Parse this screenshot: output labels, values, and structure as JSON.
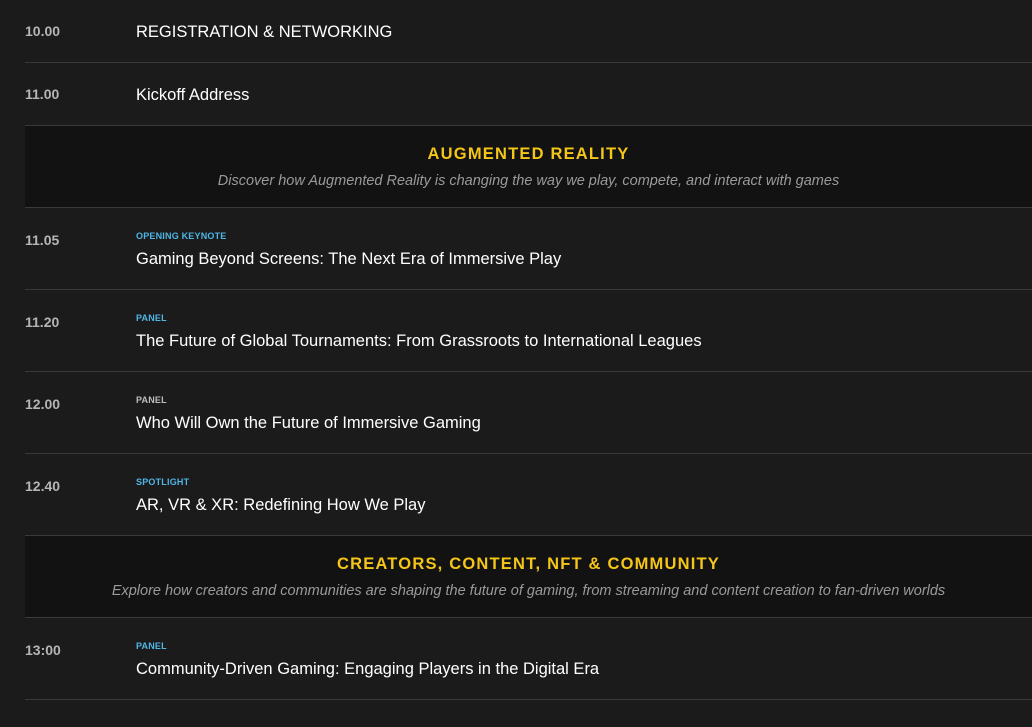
{
  "colors": {
    "background": "#1b1b1b",
    "section_background": "#121212",
    "section_title": "#f5c518",
    "tag_blue": "#4fb6e6",
    "tag_grey": "#bdbdbd",
    "time": "#b5b5b5",
    "divider": "#3a3a3a"
  },
  "agenda": {
    "row1": {
      "time": "10.00",
      "title": "REGISTRATION & NETWORKING"
    },
    "row2": {
      "time": "11.00",
      "title": "Kickoff Address"
    },
    "section1": {
      "title": "AUGMENTED REALITY",
      "description": "Discover how Augmented Reality is changing the way we play, compete, and interact with games"
    },
    "row3": {
      "time": "11.05",
      "tag": "OPENING KEYNOTE",
      "title": "Gaming Beyond Screens: The Next Era of Immersive Play"
    },
    "row4": {
      "time": "11.20",
      "tag": "PANEL",
      "title": "The Future of Global Tournaments: From Grassroots to International Leagues"
    },
    "row5": {
      "time": "12.00",
      "tag": "PANEL",
      "title": "Who Will Own the Future of Immersive Gaming"
    },
    "row6": {
      "time": "12.40",
      "tag": "SPOTLIGHT",
      "title": "AR, VR & XR: Redefining How We Play"
    },
    "section2": {
      "title": "CREATORS, CONTENT, NFT & COMMUNITY",
      "description": "Explore how creators and communities are shaping the future of gaming, from streaming and content creation to fan-driven worlds"
    },
    "row7": {
      "time": "13:00",
      "tag": "PANEL",
      "title": "Community-Driven Gaming: Engaging Players in the Digital Era"
    }
  }
}
